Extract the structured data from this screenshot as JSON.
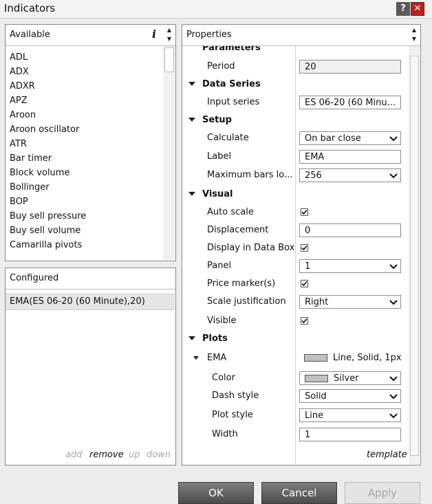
{
  "window": {
    "title": "Indicators"
  },
  "available": {
    "header": "Available",
    "info_glyph": "i",
    "items": [
      "ADL",
      "ADX",
      "ADXR",
      "APZ",
      "Aroon",
      "Aroon oscillator",
      "ATR",
      "Bar timer",
      "Block volume",
      "Bollinger",
      "BOP",
      "Buy sell pressure",
      "Buy sell volume",
      "Camarilla pivots"
    ]
  },
  "configured": {
    "header": "Configured",
    "items": [
      "EMA(ES 06-20 (60 Minute),20)"
    ],
    "actions": {
      "add": "add",
      "remove": "remove",
      "up": "up",
      "down": "down"
    }
  },
  "properties": {
    "header": "Properties",
    "parameters": {
      "title": "Parameters",
      "period_label": "Period",
      "period_value": "20"
    },
    "data_series": {
      "title": "Data Series",
      "input_series_label": "Input series",
      "input_series_value": "ES 06-20 (60 Minu..."
    },
    "setup": {
      "title": "Setup",
      "calculate_label": "Calculate",
      "calculate_value": "On bar close",
      "label_label": "Label",
      "label_value": "EMA",
      "max_bars_label": "Maximum bars lo...",
      "max_bars_value": "256"
    },
    "visual": {
      "title": "Visual",
      "auto_scale_label": "Auto scale",
      "auto_scale_checked": true,
      "displacement_label": "Displacement",
      "displacement_value": "0",
      "display_in_data_box_label": "Display in Data Box",
      "display_in_data_box_checked": true,
      "panel_label": "Panel",
      "panel_value": "1",
      "price_markers_label": "Price marker(s)",
      "price_markers_checked": true,
      "scale_justification_label": "Scale justification",
      "scale_justification_value": "Right",
      "visible_label": "Visible",
      "visible_checked": true
    },
    "plots": {
      "title": "Plots",
      "ema_label": "EMA",
      "ema_summary": "Line, Solid, 1px",
      "color_label": "Color",
      "color_value": "Silver",
      "color_hex": "#c0c0c0",
      "dash_style_label": "Dash style",
      "dash_style_value": "Solid",
      "plot_style_label": "Plot style",
      "plot_style_value": "Line",
      "width_label": "Width",
      "width_value": "1"
    },
    "template_link": "template"
  },
  "buttons": {
    "ok": "OK",
    "cancel": "Cancel",
    "apply": "Apply"
  },
  "colors": {
    "close_button": "#b8251e",
    "button_dark": "#5f5f5f"
  }
}
